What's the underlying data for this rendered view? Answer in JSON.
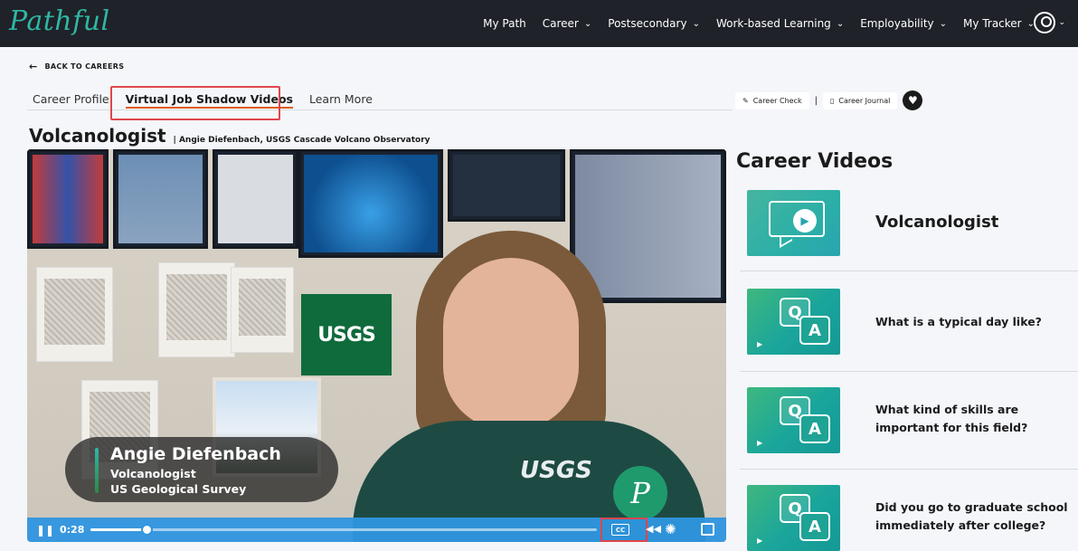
{
  "nav": {
    "logo": "Pathful",
    "items": [
      {
        "label": "My Path",
        "has_menu": false
      },
      {
        "label": "Career",
        "has_menu": true
      },
      {
        "label": "Postsecondary",
        "has_menu": true
      },
      {
        "label": "Work-based Learning",
        "has_menu": true
      },
      {
        "label": "Employability",
        "has_menu": true
      },
      {
        "label": "My Tracker",
        "has_menu": true
      }
    ],
    "chevron": "⌄"
  },
  "back_link": {
    "arrow": "←",
    "label": "BACK TO CAREERS"
  },
  "tabs": [
    "Career Profile",
    "Virtual Job Shadow Videos",
    "Learn More"
  ],
  "tools": {
    "career_check": "Career Check",
    "separator": "|",
    "career_journal": "Career Journal"
  },
  "page": {
    "title": "Volcanologist",
    "subtitle": "| Angie Diefenbach, USGS Cascade Volcano Observatory"
  },
  "video": {
    "lower_third": {
      "name": "Angie Diefenbach",
      "role": "Volcanologist",
      "org": "US Geological Survey"
    },
    "usgs_sign": "USGS",
    "shirt_logo": "USGS",
    "badge_letter": "P",
    "time": "0:28",
    "progress_fraction": 0.11,
    "cc_label": "CC"
  },
  "sidebar": {
    "title": "Career Videos",
    "items": [
      {
        "label": "Volcanologist",
        "kind": "play"
      },
      {
        "label": "What is a typical day like?",
        "kind": "qa"
      },
      {
        "label": "What kind of skills are important for this field?",
        "kind": "qa"
      },
      {
        "label": "Did you go to graduate school immediately after college?",
        "kind": "qa"
      }
    ]
  },
  "colors": {
    "nav_bg": "#1f2228",
    "logo": "#2fb7a4",
    "accent_underline": "#e25a1c",
    "highlight_box": "#e0454b",
    "player_bar": "#2f96e0"
  }
}
